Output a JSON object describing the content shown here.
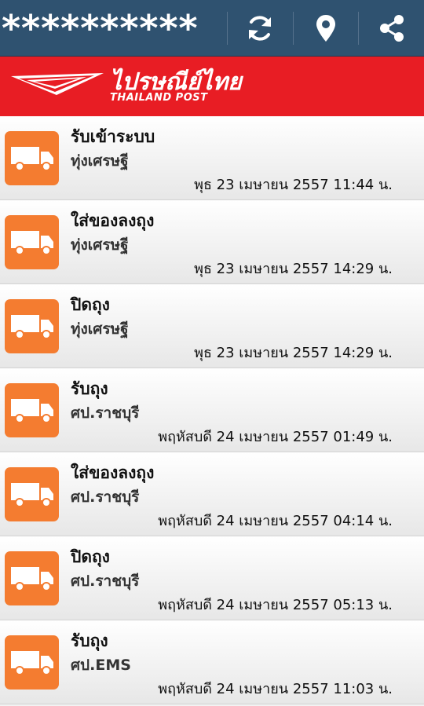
{
  "header": {
    "title": "**********",
    "actions": [
      {
        "icon": "refresh-icon"
      },
      {
        "icon": "location-pin-icon"
      },
      {
        "icon": "share-icon"
      }
    ]
  },
  "brand": {
    "thai": "ไปรษณีย์ไทย",
    "english": "THAILAND POST",
    "color": "#e81d24"
  },
  "colors": {
    "header_bg": "#2f5270",
    "badge": "#f47c30"
  },
  "events": [
    {
      "status": "รับเข้าระบบ",
      "place": "ทุ่งเศรษฐี",
      "time": "พุธ 23 เมษายน 2557 11:44 น."
    },
    {
      "status": "ใส่ของลงถุง",
      "place": "ทุ่งเศรษฐี",
      "time": "พุธ 23 เมษายน 2557 14:29 น."
    },
    {
      "status": "ปิดถุง",
      "place": "ทุ่งเศรษฐี",
      "time": "พุธ 23 เมษายน 2557 14:29 น."
    },
    {
      "status": "รับถุง",
      "place": "ศป.ราชบุรี",
      "time": "พฤหัสบดี 24 เมษายน 2557 01:49 น."
    },
    {
      "status": "ใส่ของลงถุง",
      "place": "ศป.ราชบุรี",
      "time": "พฤหัสบดี 24 เมษายน 2557 04:14 น."
    },
    {
      "status": "ปิดถุง",
      "place": "ศป.ราชบุรี",
      "time": "พฤหัสบดี 24 เมษายน 2557 05:13 น."
    },
    {
      "status": "รับถุง",
      "place": "ศป.EMS",
      "time": "พฤหัสบดี 24 เมษายน 2557 11:03 น."
    }
  ]
}
